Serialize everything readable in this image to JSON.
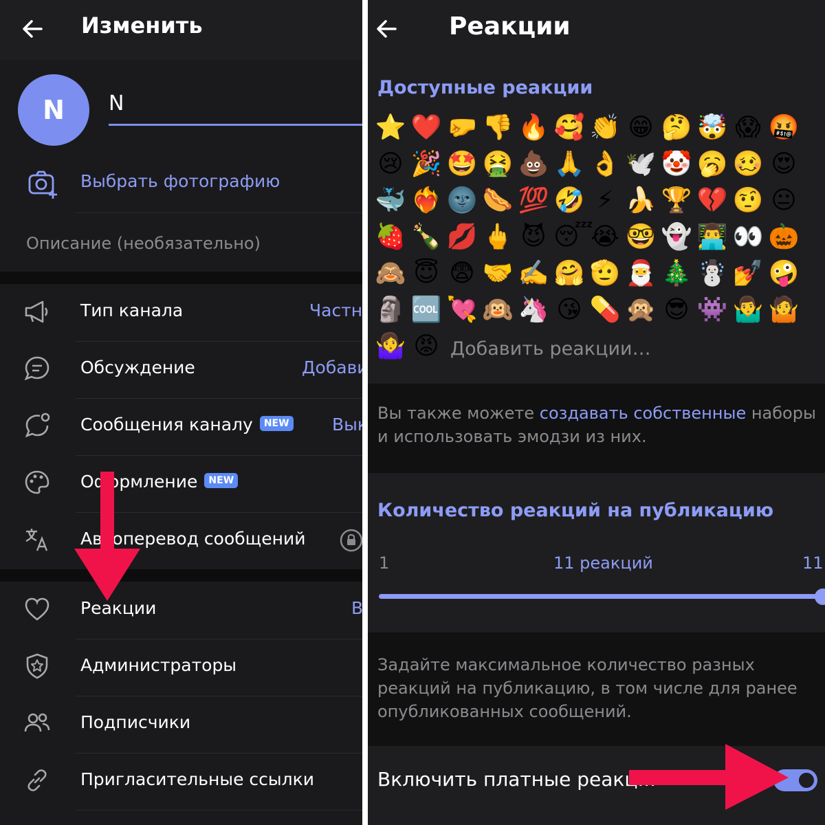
{
  "colors": {
    "accent": "#8d9cf5",
    "badge": "#5c8bf5",
    "arrow": "#f0134a",
    "bg": "#1a1a1c"
  },
  "left": {
    "title": "Изменить",
    "avatar_initial": "N",
    "name_value": "N",
    "photo_label": "Выбрать фотографию",
    "description_placeholder": "Описание (необязательно)",
    "items": [
      {
        "label": "Тип канала",
        "value": "Частны",
        "icon": "megaphone-icon"
      },
      {
        "label": "Обсуждение",
        "value": "Добави",
        "icon": "chat-bubble-icon"
      },
      {
        "label": "Сообщения каналу",
        "badge": "NEW",
        "value": "Вык",
        "icon": "chat-plus-icon"
      },
      {
        "label": "Оформление",
        "badge": "NEW",
        "icon": "palette-icon"
      },
      {
        "label": "Автоперевод сообщений",
        "icon": "translate-icon",
        "locked": true
      },
      {
        "label": "Реакции",
        "value": "В",
        "icon": "heart-icon"
      },
      {
        "label": "Администраторы",
        "icon": "shield-star-icon"
      },
      {
        "label": "Подписчики",
        "icon": "people-icon"
      },
      {
        "label": "Пригласительные ссылки",
        "icon": "link-icon"
      }
    ]
  },
  "right": {
    "title": "Реакции",
    "available_title": "Доступные реакции",
    "emojis": [
      "⭐",
      "❤️",
      "🤛",
      "👎",
      "🔥",
      "🥰",
      "👏",
      "😁",
      "🤔",
      "🤯",
      "😱",
      "🤬",
      "😢",
      "🎉",
      "🤩",
      "🤮",
      "💩",
      "🙏",
      "👌",
      "🕊️",
      "🤡",
      "🥱",
      "🥴",
      "😍",
      "🐳",
      "❤️‍🔥",
      "🌚",
      "🌭",
      "💯",
      "🤣",
      "⚡",
      "🍌",
      "🏆",
      "💔",
      "🤨",
      "😐",
      "🍓",
      "🍾",
      "💋",
      "🖕",
      "😈",
      "😴",
      "😭",
      "🤓",
      "👻",
      "👨‍💻",
      "👀",
      "🎃",
      "🙈",
      "😇",
      "😨",
      "🤝",
      "✍️",
      "🤗",
      "🫡",
      "🎅",
      "🎄",
      "☃️",
      "💅",
      "🤪",
      "🗿",
      "🆒",
      "💘",
      "🙉",
      "🦄",
      "😘",
      "💊",
      "🙊",
      "😎",
      "👾",
      "🤷‍♂️",
      "🤷",
      "🤷‍♀️",
      "😡"
    ],
    "add_reactions": "Добавить реакции…",
    "note_prefix": "Вы также можете ",
    "note_link": "создавать собственные",
    "note_suffix": " наборы и использовать эмодзи из них.",
    "count_title": "Количество реакций на публикацию",
    "slider_min": "1",
    "slider_current": "11 реакций",
    "slider_max": "11",
    "slider_value": 1.0,
    "count_note": "Задайте максимальное количество разных реакций на публикацию, в том числе для ранее опубликованных сообщений.",
    "paid_label": "Включить платные реакц...",
    "paid_enabled": true
  }
}
